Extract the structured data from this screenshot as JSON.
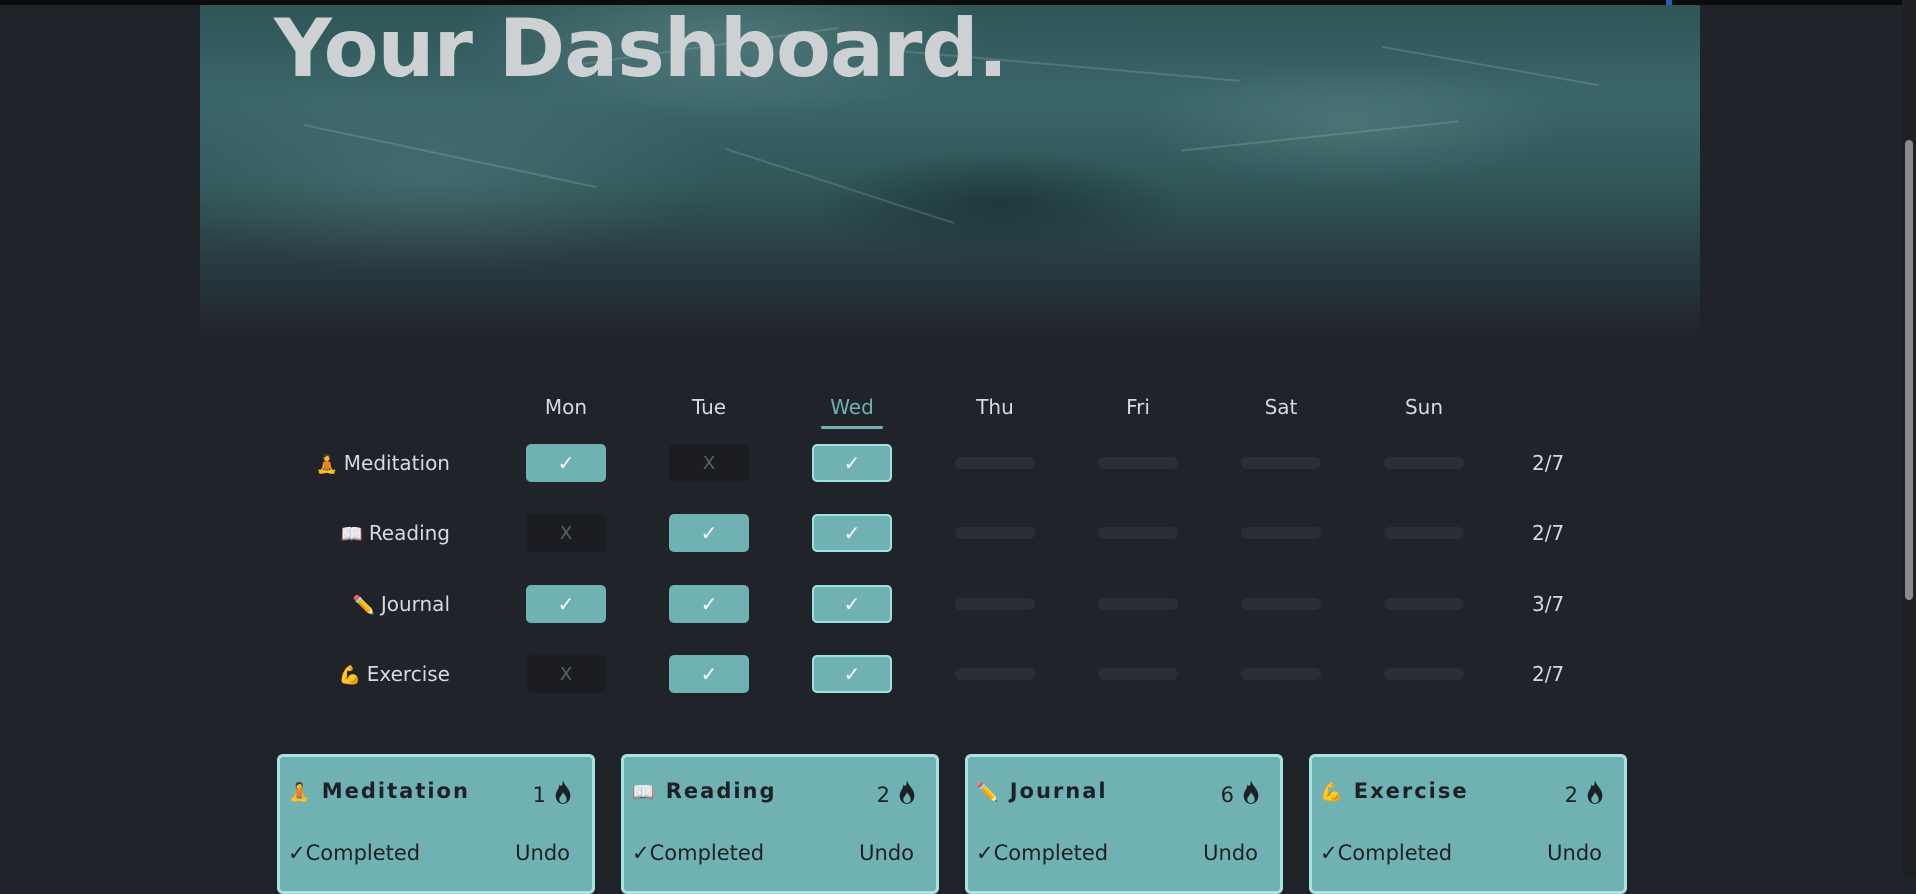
{
  "title": "Your Dashboard.",
  "days": [
    "Mon",
    "Tue",
    "Wed",
    "Thu",
    "Fri",
    "Sat",
    "Sun"
  ],
  "active_day": "Wed",
  "habits": [
    {
      "emoji": "🧘",
      "name": "Meditation",
      "days": [
        "done",
        "miss",
        "done",
        "",
        "",
        "",
        ""
      ],
      "score": "2/7"
    },
    {
      "emoji": "📖",
      "name": "Reading",
      "days": [
        "miss",
        "done",
        "done",
        "",
        "",
        "",
        ""
      ],
      "score": "2/7"
    },
    {
      "emoji": "✏️",
      "name": "Journal",
      "days": [
        "done",
        "done",
        "done",
        "",
        "",
        "",
        ""
      ],
      "score": "3/7"
    },
    {
      "emoji": "💪",
      "name": "Exercise",
      "days": [
        "miss",
        "done",
        "done",
        "",
        "",
        "",
        ""
      ],
      "score": "2/7"
    }
  ],
  "marks": {
    "done": "✓",
    "miss": "X"
  },
  "cards": [
    {
      "emoji": "🧘",
      "name": "Meditation",
      "streak": "1",
      "status": "✓Completed",
      "undo": "Undo"
    },
    {
      "emoji": "📖",
      "name": "Reading",
      "streak": "2",
      "status": "✓Completed",
      "undo": "Undo"
    },
    {
      "emoji": "✏️",
      "name": "Journal",
      "streak": "6",
      "status": "✓Completed",
      "undo": "Undo"
    },
    {
      "emoji": "💪",
      "name": "Exercise",
      "streak": "2",
      "status": "✓Completed",
      "undo": "Undo"
    }
  ],
  "colors": {
    "accent": "#70b2b3",
    "background": "#21232b",
    "today_border": "#9fe0e0"
  },
  "icons": {
    "streak": "flame-icon"
  }
}
